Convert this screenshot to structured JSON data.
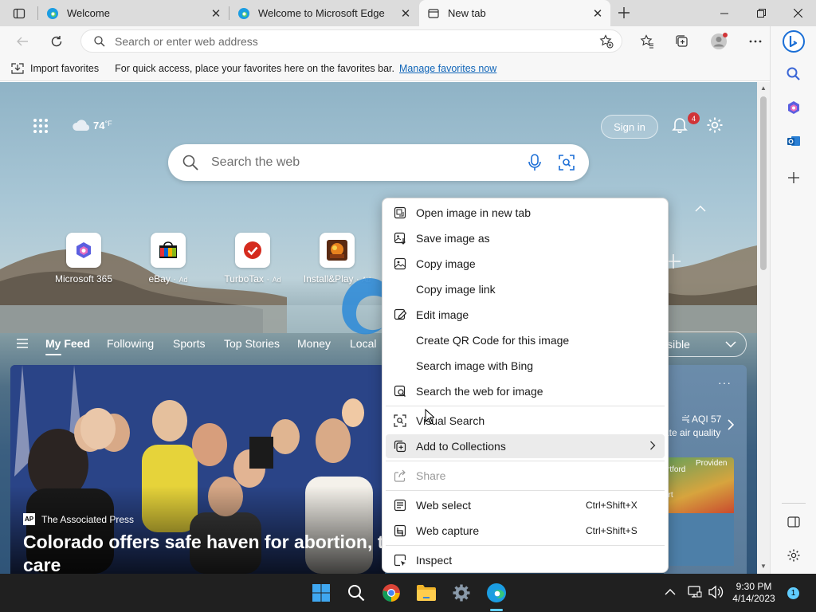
{
  "tabs": [
    {
      "title": "Welcome",
      "active": false
    },
    {
      "title": "Welcome to Microsoft Edge",
      "active": false
    },
    {
      "title": "New tab",
      "active": true
    }
  ],
  "address_bar": {
    "placeholder": "Search or enter web address"
  },
  "favorites_bar": {
    "import_label": "Import favorites",
    "hint": "For quick access, place your favorites here on the favorites bar.",
    "manage_link": "Manage favorites now"
  },
  "new_tab_page": {
    "weather_temp": "74",
    "weather_unit": "°F",
    "sign_in_label": "Sign in",
    "notification_count": "4",
    "search_placeholder": "Search the web",
    "quick_links": [
      {
        "label": "Microsoft 365",
        "ad": ""
      },
      {
        "label": "eBay",
        "ad": "Ad"
      },
      {
        "label": "TurboTax",
        "ad": "Ad"
      },
      {
        "label": "Install&Play",
        "ad": "Ad"
      }
    ],
    "feed_tabs": [
      "My Feed",
      "Following",
      "Sports",
      "Top Stories",
      "Money",
      "Local"
    ],
    "layout_select": "isible",
    "hero": {
      "source": "The Associated Press",
      "headline": "Colorado offers safe haven for abortion, t care"
    },
    "side_card": {
      "aqi": "AQI 57",
      "aqi_desc": "ate air quality",
      "map_labels": [
        "rtford",
        "Providen",
        "ort"
      ]
    }
  },
  "context_menu": {
    "items": [
      {
        "label": "Open image in new tab",
        "icon": "open-new-tab-icon",
        "shortcut": "",
        "disabled": false
      },
      {
        "label": "Save image as",
        "icon": "save-image-icon",
        "shortcut": "",
        "disabled": false
      },
      {
        "label": "Copy image",
        "icon": "copy-image-icon",
        "shortcut": "",
        "disabled": false
      },
      {
        "label": "Copy image link",
        "icon": "",
        "shortcut": "",
        "disabled": false
      },
      {
        "label": "Edit image",
        "icon": "edit-image-icon",
        "shortcut": "",
        "disabled": false
      },
      {
        "label": "Create QR Code for this image",
        "icon": "",
        "shortcut": "",
        "disabled": false
      },
      {
        "label": "Search image with Bing",
        "icon": "",
        "shortcut": "",
        "disabled": false
      },
      {
        "label": "Search the web for image",
        "icon": "search-web-image-icon",
        "shortcut": "",
        "disabled": false
      },
      {
        "label": "Visual Search",
        "icon": "visual-search-icon",
        "shortcut": "",
        "disabled": false
      },
      {
        "label": "Add to Collections",
        "icon": "collections-icon",
        "shortcut": "",
        "disabled": false,
        "submenu": true,
        "hover": true
      },
      {
        "label": "Share",
        "icon": "share-icon",
        "shortcut": "",
        "disabled": true
      },
      {
        "label": "Web select",
        "icon": "web-select-icon",
        "shortcut": "Ctrl+Shift+X",
        "disabled": false
      },
      {
        "label": "Web capture",
        "icon": "web-capture-icon",
        "shortcut": "Ctrl+Shift+S",
        "disabled": false
      },
      {
        "label": "Inspect",
        "icon": "inspect-icon",
        "shortcut": "",
        "disabled": false
      }
    ]
  },
  "taskbar": {
    "time": "9:30 PM",
    "date": "4/14/2023",
    "notification_count": "1"
  },
  "colors": {
    "accent": "#0078d4",
    "link": "#1065b8",
    "taskbar": "#202020"
  }
}
